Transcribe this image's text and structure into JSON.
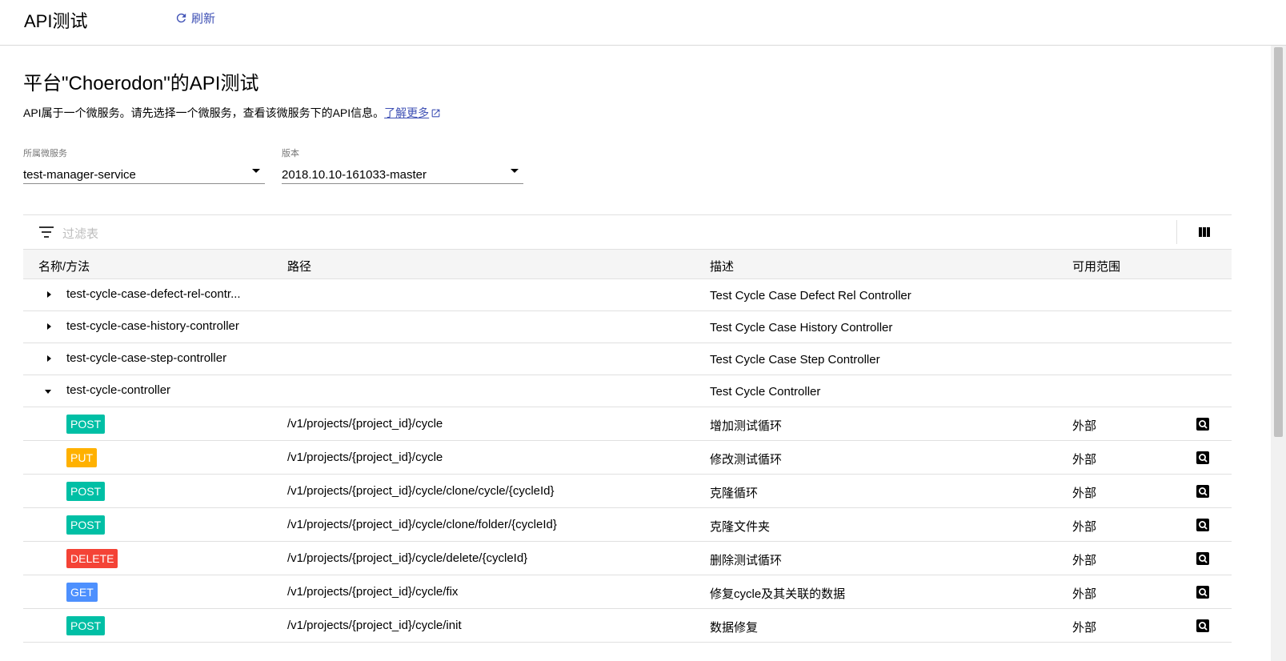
{
  "header": {
    "title": "API测试",
    "refresh_label": "刷新"
  },
  "page": {
    "title": "平台\"Choerodon\"的API测试",
    "description": "API属于一个微服务。请先选择一个微服务，查看该微服务下的API信息。",
    "learn_more": "了解更多"
  },
  "filters": {
    "service": {
      "label": "所属微服务",
      "value": "test-manager-service"
    },
    "version": {
      "label": "版本",
      "value": "2018.10.10-161033-master"
    }
  },
  "table": {
    "filter_placeholder": "过滤表",
    "columns": {
      "name": "名称/方法",
      "path": "路径",
      "desc": "描述",
      "scope": "可用范围"
    },
    "controllers": [
      {
        "name": "test-cycle-case-defect-rel-contr...",
        "desc": "Test Cycle Case Defect Rel Controller",
        "expanded": false
      },
      {
        "name": "test-cycle-case-history-controller",
        "desc": "Test Cycle Case History Controller",
        "expanded": false
      },
      {
        "name": "test-cycle-case-step-controller",
        "desc": "Test Cycle Case Step Controller",
        "expanded": false
      },
      {
        "name": "test-cycle-controller",
        "desc": "Test Cycle Controller",
        "expanded": true
      }
    ],
    "apis": [
      {
        "method": "POST",
        "path": "/v1/projects/{project_id}/cycle",
        "desc": "增加测试循环",
        "scope": "外部"
      },
      {
        "method": "PUT",
        "path": "/v1/projects/{project_id}/cycle",
        "desc": "修改测试循环",
        "scope": "外部"
      },
      {
        "method": "POST",
        "path": "/v1/projects/{project_id}/cycle/clone/cycle/{cycleId}",
        "desc": "克隆循环",
        "scope": "外部"
      },
      {
        "method": "POST",
        "path": "/v1/projects/{project_id}/cycle/clone/folder/{cycleId}",
        "desc": "克隆文件夹",
        "scope": "外部"
      },
      {
        "method": "DELETE",
        "path": "/v1/projects/{project_id}/cycle/delete/{cycleId}",
        "desc": "删除测试循环",
        "scope": "外部"
      },
      {
        "method": "GET",
        "path": "/v1/projects/{project_id}/cycle/fix",
        "desc": "修复cycle及其关联的数据",
        "scope": "外部"
      },
      {
        "method": "POST",
        "path": "/v1/projects/{project_id}/cycle/init",
        "desc": "数据修复",
        "scope": "外部"
      }
    ]
  },
  "colors": {
    "POST": "#00bfa5",
    "PUT": "#ffb100",
    "DELETE": "#f44336",
    "GET": "#4d90fe",
    "link": "#3f51b5"
  }
}
